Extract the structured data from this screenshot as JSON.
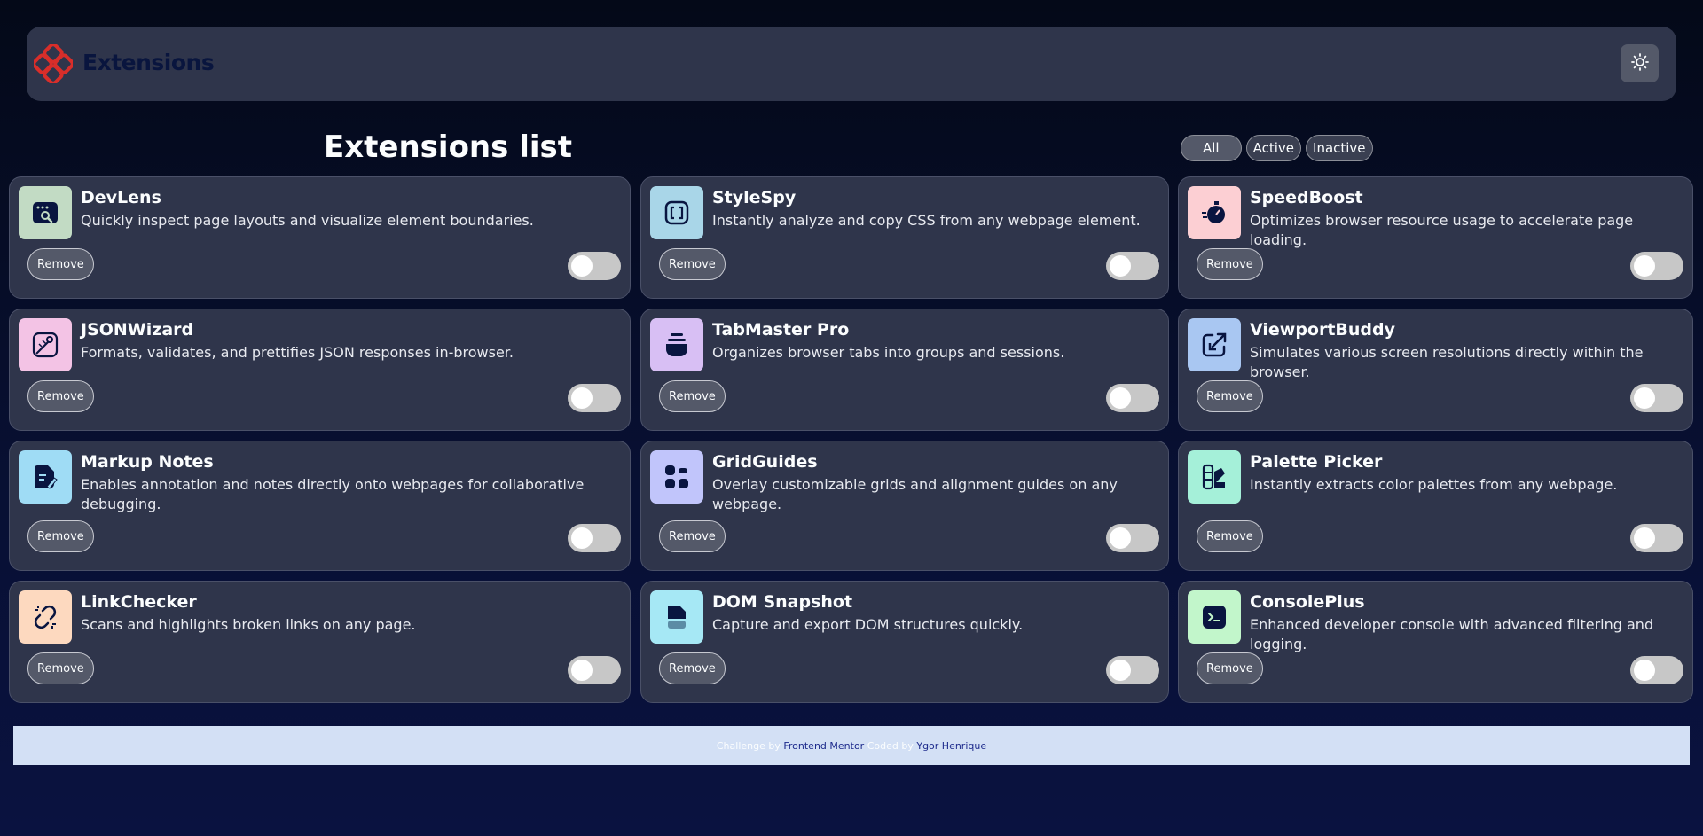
{
  "header": {
    "logo_text": "Extensions",
    "logo_icon": "extensions-logo-icon",
    "theme_toggle_icon": "sun-icon"
  },
  "main": {
    "title": "Extensions list",
    "filters": [
      {
        "label": "All"
      },
      {
        "label": "Active"
      },
      {
        "label": "Inactive"
      }
    ]
  },
  "extensions": [
    {
      "name": "DevLens",
      "description": "Quickly inspect page layouts and visualize element boundaries.",
      "icon": "devlens-icon",
      "icon_bg": "#c2dbc4",
      "remove_label": "Remove",
      "active": false
    },
    {
      "name": "StyleSpy",
      "description": "Instantly analyze and copy CSS from any webpage element.",
      "icon": "stylespy-icon",
      "icon_bg": "#a9d6e8",
      "remove_label": "Remove",
      "active": false
    },
    {
      "name": "SpeedBoost",
      "description": "Optimizes browser resource usage to accelerate page loading.",
      "icon": "speedboost-icon",
      "icon_bg": "#fccfd3",
      "remove_label": "Remove",
      "active": false
    },
    {
      "name": "JSONWizard",
      "description": "Formats, validates, and prettifies JSON responses in-browser.",
      "icon": "jsonwizard-icon",
      "icon_bg": "#f3c3e5",
      "remove_label": "Remove",
      "active": false
    },
    {
      "name": "TabMaster Pro",
      "description": "Organizes browser tabs into groups and sessions.",
      "icon": "tabmaster-icon",
      "icon_bg": "#d8bff4",
      "remove_label": "Remove",
      "active": false
    },
    {
      "name": "ViewportBuddy",
      "description": "Simulates various screen resolutions directly within the browser.",
      "icon": "viewportbuddy-icon",
      "icon_bg": "#a9c7f2",
      "remove_label": "Remove",
      "active": false
    },
    {
      "name": "Markup Notes",
      "description": "Enables annotation and notes directly onto webpages for collaborative debugging.",
      "icon": "markup-notes-icon",
      "icon_bg": "#9fdcf5",
      "remove_label": "Remove",
      "active": false
    },
    {
      "name": "GridGuides",
      "description": "Overlay customizable grids and alignment guides on any webpage.",
      "icon": "gridguides-icon",
      "icon_bg": "#c1c5fb",
      "remove_label": "Remove",
      "active": false
    },
    {
      "name": "Palette Picker",
      "description": "Instantly extracts color palettes from any webpage.",
      "icon": "palette-picker-icon",
      "icon_bg": "#a5f0d9",
      "remove_label": "Remove",
      "active": false
    },
    {
      "name": "LinkChecker",
      "description": "Scans and highlights broken links on any page.",
      "icon": "linkchecker-icon",
      "icon_bg": "#fdd9bf",
      "remove_label": "Remove",
      "active": false
    },
    {
      "name": "DOM Snapshot",
      "description": "Capture and export DOM structures quickly.",
      "icon": "dom-snapshot-icon",
      "icon_bg": "#a6e8f5",
      "remove_label": "Remove",
      "active": false
    },
    {
      "name": "ConsolePlus",
      "description": "Enhanced developer console with advanced filtering and logging.",
      "icon": "consoleplus-icon",
      "icon_bg": "#c2f6cb",
      "remove_label": "Remove",
      "active": false
    }
  ],
  "footer": {
    "challenge_text": "Challenge by",
    "challenge_link": "Frontend Mentor",
    "coded_text": "Coded by",
    "author_link": "Ygor Henrique"
  },
  "colors": {
    "background": "#040918",
    "card": "#2f354b",
    "logo_red": "#d82e2a",
    "toggle_off": "#c7c7c7"
  }
}
